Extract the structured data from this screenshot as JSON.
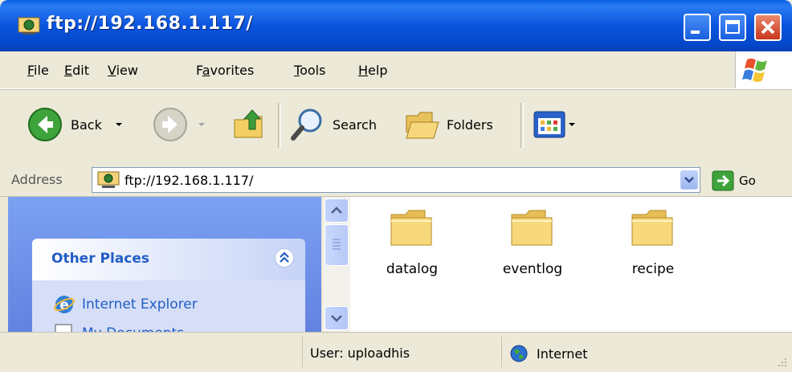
{
  "window": {
    "title": "ftp://192.168.1.117/"
  },
  "menu": {
    "items": [
      {
        "label": "File",
        "accel": "F"
      },
      {
        "label": "Edit",
        "accel": "E"
      },
      {
        "label": "View",
        "accel": "V"
      },
      {
        "label": "Favorites",
        "accel": "a"
      },
      {
        "label": "Tools",
        "accel": "T"
      },
      {
        "label": "Help",
        "accel": "H"
      }
    ]
  },
  "toolbar": {
    "back_label": "Back",
    "search_label": "Search",
    "folders_label": "Folders"
  },
  "address": {
    "label": "Address",
    "value": "ftp://192.168.1.117/",
    "go_label": "Go"
  },
  "sidebar": {
    "panel_title": "Other Places",
    "links": [
      "Internet Explorer",
      "My Documents"
    ]
  },
  "folders": [
    {
      "name": "datalog"
    },
    {
      "name": "eventlog"
    },
    {
      "name": "recipe"
    }
  ],
  "status": {
    "user": "User: uploadhis",
    "zone": "Internet"
  },
  "colors": {
    "titlebar": "#0a54de",
    "sidebar": "#6f92ea",
    "link": "#215dc6",
    "folder": "#f7d97b"
  }
}
